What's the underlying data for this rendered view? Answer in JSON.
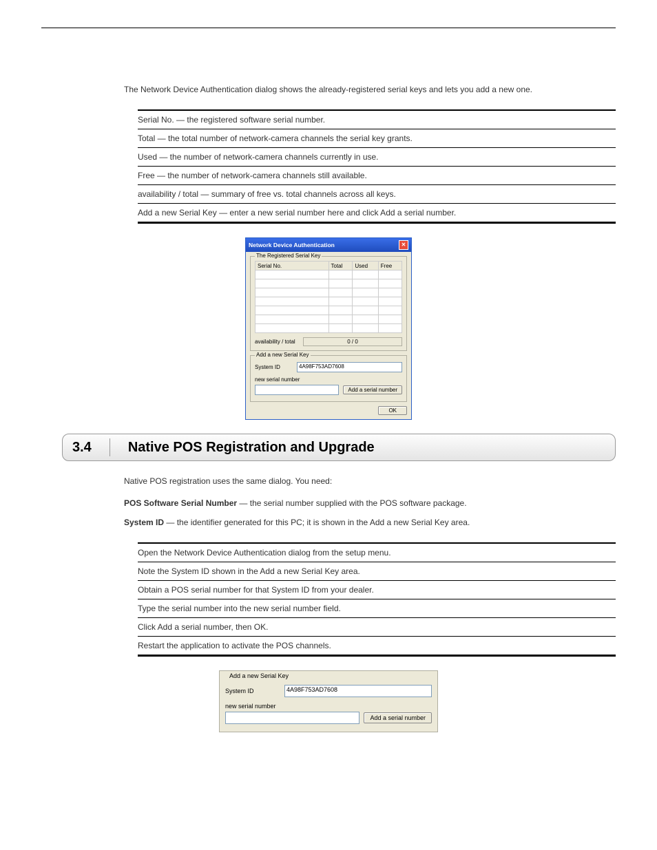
{
  "intro_text": "The Network Device Authentication dialog shows the already-registered serial keys and lets you add a new one.",
  "bullets": [
    "Serial No. — the registered software serial number.",
    "Total — the total number of network-camera channels the serial key grants.",
    "Used — the number of network-camera channels currently in use.",
    "Free — the number of network-camera channels still available.",
    "availability / total — summary of free vs. total channels across all keys.",
    "Add a new Serial Key — enter a new serial number here and click Add a serial number."
  ],
  "dialog": {
    "title": "Network Device Authentication",
    "group1": {
      "legend": "The Registered Serial Key",
      "cols": [
        "Serial No.",
        "Total",
        "Used",
        "Free"
      ],
      "avail_label": "availability / total",
      "avail_value": "0 / 0"
    },
    "group2": {
      "legend": "Add a new Serial Key",
      "sysid_label": "System ID",
      "sysid_value": "4A98F753AD7608",
      "newserial_label": "new serial number",
      "add_btn": "Add a serial number"
    },
    "ok": "OK"
  },
  "section": {
    "num": "3.4",
    "title": "Native POS Registration and Upgrade"
  },
  "section_intro": "Native POS registration uses the same dialog. You need:",
  "defs": {
    "pos_label": "POS Software Serial Number",
    "pos_text": " — the serial number supplied with the POS software package.",
    "sys_label": "System ID",
    "sys_text": " — the identifier generated for this PC; it is shown in the Add a new Serial Key area."
  },
  "bullets2": [
    "Open the Network Device Authentication dialog from the setup menu.",
    "Note the System ID shown in the Add a new Serial Key area.",
    "Obtain a POS serial number for that System ID from your dealer.",
    "Type the serial number into the new serial number field.",
    "Click Add a serial number, then OK.",
    "Restart the application to activate the POS channels."
  ],
  "panel2": {
    "legend": "Add a new Serial Key",
    "sysid_label": "System ID",
    "sysid_value": "4A98F753AD7608",
    "newserial_label": "new serial number",
    "add_btn": "Add a serial number"
  }
}
